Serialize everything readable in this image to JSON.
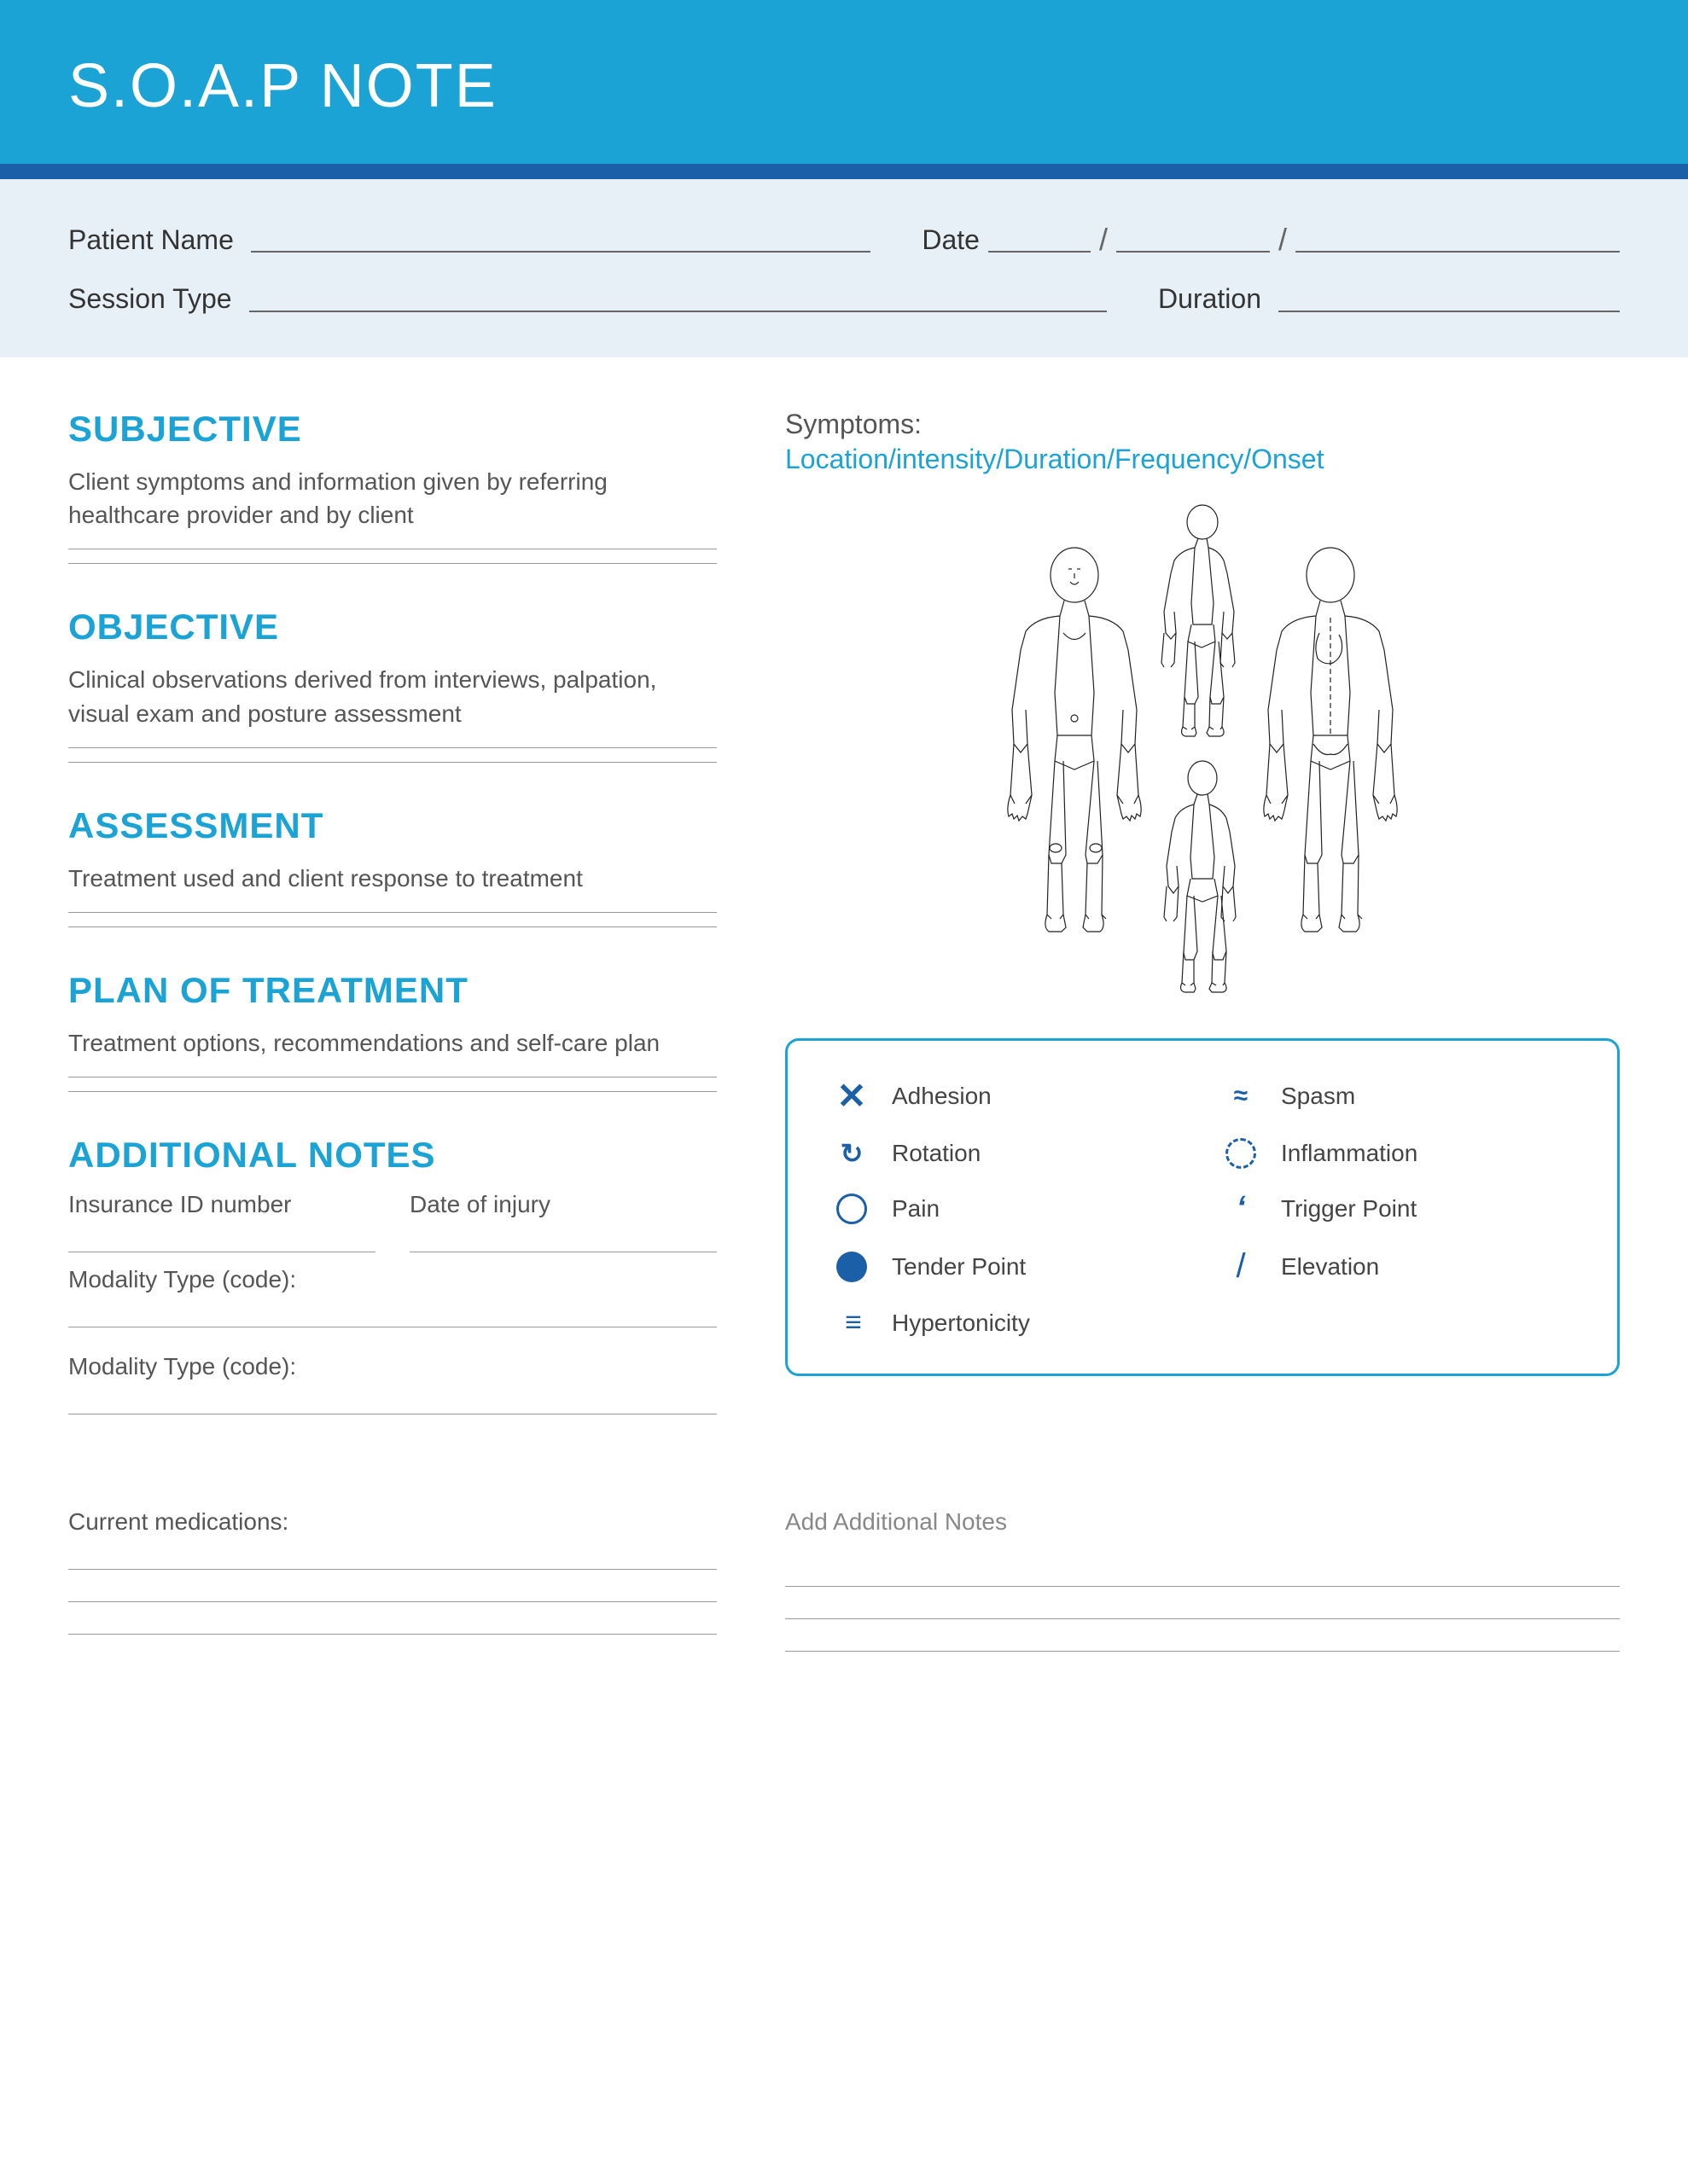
{
  "header": {
    "title": "S.O.A.P NOTE"
  },
  "patient_info": {
    "patient_name_label": "Patient Name",
    "date_label": "Date",
    "session_type_label": "Session Type",
    "duration_label": "Duration"
  },
  "subjective": {
    "title": "SUBJECTIVE",
    "description": "Client symptoms and information given by referring healthcare provider and by client"
  },
  "objective": {
    "title": "OBJECTIVE",
    "description": "Clinical observations derived from interviews, palpation, visual exam and posture assessment"
  },
  "assessment": {
    "title": "ASSESSMENT",
    "description": "Treatment used and client response to treatment"
  },
  "plan": {
    "title": "PLAN OF TREATMENT",
    "description": "Treatment options, recommendations and self-care plan"
  },
  "additional_notes": {
    "title": "ADDITIONAL NOTES",
    "insurance_id_label": "Insurance ID number",
    "date_of_injury_label": "Date of injury",
    "modality1_label": "Modality Type (code):",
    "modality2_label": "Modality Type (code):",
    "medications_label": "Current medications:"
  },
  "symptoms": {
    "label": "Symptoms:",
    "detail": "Location/intensity/Duration/Frequency/Onset"
  },
  "legend": {
    "items_left": [
      {
        "symbol": "×",
        "label": "Adhesion",
        "type": "x"
      },
      {
        "symbol": "↻",
        "label": "Rotation",
        "type": "rotate"
      },
      {
        "symbol": "○",
        "label": "Pain",
        "type": "circle-o"
      },
      {
        "symbol": "●",
        "label": "Tender Point",
        "type": "circle-filled"
      },
      {
        "symbol": "≡",
        "label": "Hypertonicity",
        "type": "equals"
      }
    ],
    "items_right": [
      {
        "symbol": "≈",
        "label": "Spasm",
        "type": "waves"
      },
      {
        "symbol": "◎",
        "label": "Inflammation",
        "type": "circle-dashed"
      },
      {
        "symbol": "ʻ",
        "label": "Trigger Point",
        "type": "trigger"
      },
      {
        "symbol": "/",
        "label": "Elevation",
        "type": "slash"
      }
    ]
  },
  "add_notes_label": "Add Additional Notes"
}
